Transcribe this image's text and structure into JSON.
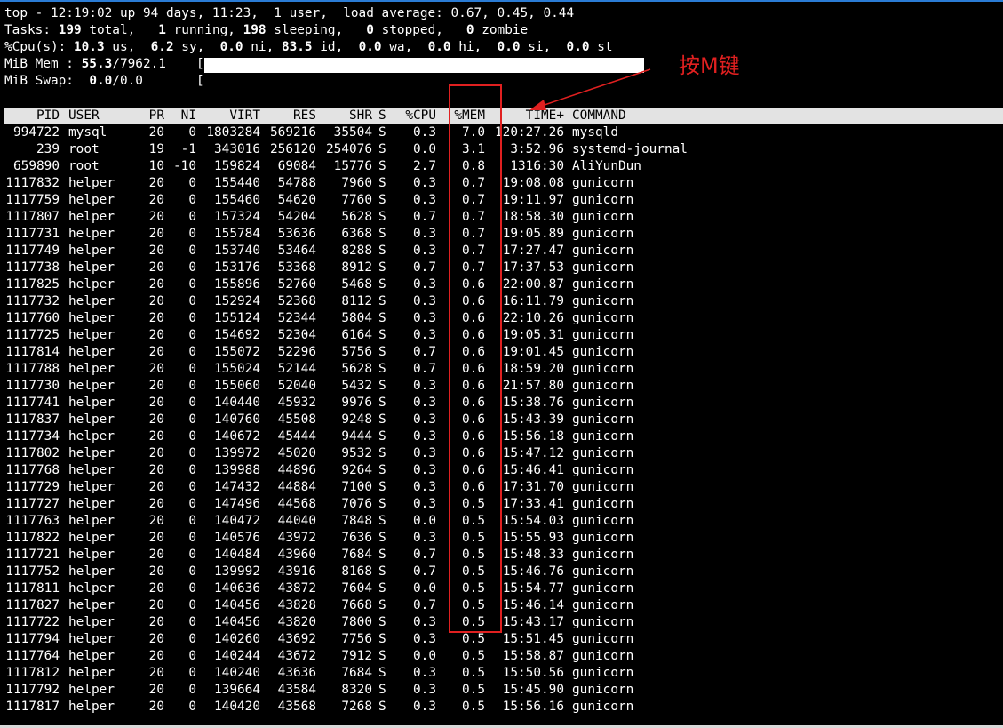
{
  "summary": {
    "top_line": "top - 12:19:02 up 94 days, 11:23,  1 user,  load average: 0.67, 0.45, 0.44",
    "tasks": {
      "prefix": "Tasks: ",
      "total": "199",
      "total_label": " total,   ",
      "running": "1",
      "running_label": " running, ",
      "sleeping": "198",
      "sleeping_label": " sleeping,   ",
      "stopped": "0",
      "stopped_label": " stopped,   ",
      "zombie": "0",
      "zombie_label": " zombie"
    },
    "cpu": {
      "prefix": "%Cpu(s): ",
      "us": "10.3",
      "us_label": " us,  ",
      "sy": "6.2",
      "sy_label": " sy,  ",
      "ni": "0.0",
      "ni_label": " ni, ",
      "id": "83.5",
      "id_label": " id,  ",
      "wa": "0.0",
      "wa_label": " wa,  ",
      "hi": "0.0",
      "hi_label": " hi,  ",
      "si": "0.0",
      "si_label": " si,  ",
      "st": "0.0",
      "st_label": " st"
    },
    "mem": {
      "prefix": "MiB Mem : ",
      "used_pct": "55.3",
      "total": "/7962.1",
      "bracket": "[",
      "bar_fraction": 0.553
    },
    "swap": {
      "prefix": "MiB Swap:  ",
      "used_pct": "0.0",
      "total": "/0.0",
      "bracket": "["
    }
  },
  "columns": [
    "PID",
    "USER",
    "PR",
    "NI",
    "VIRT",
    "RES",
    "SHR",
    "S",
    "%CPU",
    "%MEM",
    "TIME+",
    "COMMAND"
  ],
  "processes": [
    [
      "994722",
      "mysql",
      "20",
      "0",
      "1803284",
      "569216",
      "35504",
      "S",
      "0.3",
      "7.0",
      "120:27.26",
      "mysqld"
    ],
    [
      "239",
      "root",
      "19",
      "-1",
      "343016",
      "256120",
      "254076",
      "S",
      "0.0",
      "3.1",
      "3:52.96",
      "systemd-journal"
    ],
    [
      "659890",
      "root",
      "10",
      "-10",
      "159824",
      "69084",
      "15776",
      "S",
      "2.7",
      "0.8",
      "1316:30",
      "AliYunDun"
    ],
    [
      "1117832",
      "helper",
      "20",
      "0",
      "155440",
      "54788",
      "7960",
      "S",
      "0.3",
      "0.7",
      "19:08.08",
      "gunicorn"
    ],
    [
      "1117759",
      "helper",
      "20",
      "0",
      "155460",
      "54620",
      "7760",
      "S",
      "0.3",
      "0.7",
      "19:11.97",
      "gunicorn"
    ],
    [
      "1117807",
      "helper",
      "20",
      "0",
      "157324",
      "54204",
      "5628",
      "S",
      "0.7",
      "0.7",
      "18:58.30",
      "gunicorn"
    ],
    [
      "1117731",
      "helper",
      "20",
      "0",
      "155784",
      "53636",
      "6368",
      "S",
      "0.3",
      "0.7",
      "19:05.89",
      "gunicorn"
    ],
    [
      "1117749",
      "helper",
      "20",
      "0",
      "153740",
      "53464",
      "8288",
      "S",
      "0.3",
      "0.7",
      "17:27.47",
      "gunicorn"
    ],
    [
      "1117738",
      "helper",
      "20",
      "0",
      "153176",
      "53368",
      "8912",
      "S",
      "0.7",
      "0.7",
      "17:37.53",
      "gunicorn"
    ],
    [
      "1117825",
      "helper",
      "20",
      "0",
      "155896",
      "52760",
      "5468",
      "S",
      "0.3",
      "0.6",
      "22:00.87",
      "gunicorn"
    ],
    [
      "1117732",
      "helper",
      "20",
      "0",
      "152924",
      "52368",
      "8112",
      "S",
      "0.3",
      "0.6",
      "16:11.79",
      "gunicorn"
    ],
    [
      "1117760",
      "helper",
      "20",
      "0",
      "155124",
      "52344",
      "5804",
      "S",
      "0.3",
      "0.6",
      "22:10.26",
      "gunicorn"
    ],
    [
      "1117725",
      "helper",
      "20",
      "0",
      "154692",
      "52304",
      "6164",
      "S",
      "0.3",
      "0.6",
      "19:05.31",
      "gunicorn"
    ],
    [
      "1117814",
      "helper",
      "20",
      "0",
      "155072",
      "52296",
      "5756",
      "S",
      "0.7",
      "0.6",
      "19:01.45",
      "gunicorn"
    ],
    [
      "1117788",
      "helper",
      "20",
      "0",
      "155024",
      "52144",
      "5628",
      "S",
      "0.7",
      "0.6",
      "18:59.20",
      "gunicorn"
    ],
    [
      "1117730",
      "helper",
      "20",
      "0",
      "155060",
      "52040",
      "5432",
      "S",
      "0.3",
      "0.6",
      "21:57.80",
      "gunicorn"
    ],
    [
      "1117741",
      "helper",
      "20",
      "0",
      "140440",
      "45932",
      "9976",
      "S",
      "0.3",
      "0.6",
      "15:38.76",
      "gunicorn"
    ],
    [
      "1117837",
      "helper",
      "20",
      "0",
      "140760",
      "45508",
      "9248",
      "S",
      "0.3",
      "0.6",
      "15:43.39",
      "gunicorn"
    ],
    [
      "1117734",
      "helper",
      "20",
      "0",
      "140672",
      "45444",
      "9444",
      "S",
      "0.3",
      "0.6",
      "15:56.18",
      "gunicorn"
    ],
    [
      "1117802",
      "helper",
      "20",
      "0",
      "139972",
      "45020",
      "9532",
      "S",
      "0.3",
      "0.6",
      "15:47.12",
      "gunicorn"
    ],
    [
      "1117768",
      "helper",
      "20",
      "0",
      "139988",
      "44896",
      "9264",
      "S",
      "0.3",
      "0.6",
      "15:46.41",
      "gunicorn"
    ],
    [
      "1117729",
      "helper",
      "20",
      "0",
      "147432",
      "44884",
      "7100",
      "S",
      "0.3",
      "0.6",
      "17:31.70",
      "gunicorn"
    ],
    [
      "1117727",
      "helper",
      "20",
      "0",
      "147496",
      "44568",
      "7076",
      "S",
      "0.3",
      "0.5",
      "17:33.41",
      "gunicorn"
    ],
    [
      "1117763",
      "helper",
      "20",
      "0",
      "140472",
      "44040",
      "7848",
      "S",
      "0.0",
      "0.5",
      "15:54.03",
      "gunicorn"
    ],
    [
      "1117822",
      "helper",
      "20",
      "0",
      "140576",
      "43972",
      "7636",
      "S",
      "0.3",
      "0.5",
      "15:55.93",
      "gunicorn"
    ],
    [
      "1117721",
      "helper",
      "20",
      "0",
      "140484",
      "43960",
      "7684",
      "S",
      "0.7",
      "0.5",
      "15:48.33",
      "gunicorn"
    ],
    [
      "1117752",
      "helper",
      "20",
      "0",
      "139992",
      "43916",
      "8168",
      "S",
      "0.7",
      "0.5",
      "15:46.76",
      "gunicorn"
    ],
    [
      "1117811",
      "helper",
      "20",
      "0",
      "140636",
      "43872",
      "7604",
      "S",
      "0.0",
      "0.5",
      "15:54.77",
      "gunicorn"
    ],
    [
      "1117827",
      "helper",
      "20",
      "0",
      "140456",
      "43828",
      "7668",
      "S",
      "0.7",
      "0.5",
      "15:46.14",
      "gunicorn"
    ],
    [
      "1117722",
      "helper",
      "20",
      "0",
      "140456",
      "43820",
      "7800",
      "S",
      "0.3",
      "0.5",
      "15:43.17",
      "gunicorn"
    ],
    [
      "1117794",
      "helper",
      "20",
      "0",
      "140260",
      "43692",
      "7756",
      "S",
      "0.3",
      "0.5",
      "15:51.45",
      "gunicorn"
    ],
    [
      "1117764",
      "helper",
      "20",
      "0",
      "140244",
      "43672",
      "7912",
      "S",
      "0.0",
      "0.5",
      "15:58.87",
      "gunicorn"
    ],
    [
      "1117812",
      "helper",
      "20",
      "0",
      "140240",
      "43636",
      "7684",
      "S",
      "0.3",
      "0.5",
      "15:50.56",
      "gunicorn"
    ],
    [
      "1117792",
      "helper",
      "20",
      "0",
      "139664",
      "43584",
      "8320",
      "S",
      "0.3",
      "0.5",
      "15:45.90",
      "gunicorn"
    ],
    [
      "1117817",
      "helper",
      "20",
      "0",
      "140420",
      "43568",
      "7268",
      "S",
      "0.3",
      "0.5",
      "15:56.16",
      "gunicorn"
    ]
  ],
  "annotation": {
    "text": "按M键",
    "color": "#e02020"
  },
  "colors": {
    "background": "#000000",
    "text": "#ffffff",
    "header_bg": "#e3e3e3",
    "highlight": "#e02020"
  }
}
